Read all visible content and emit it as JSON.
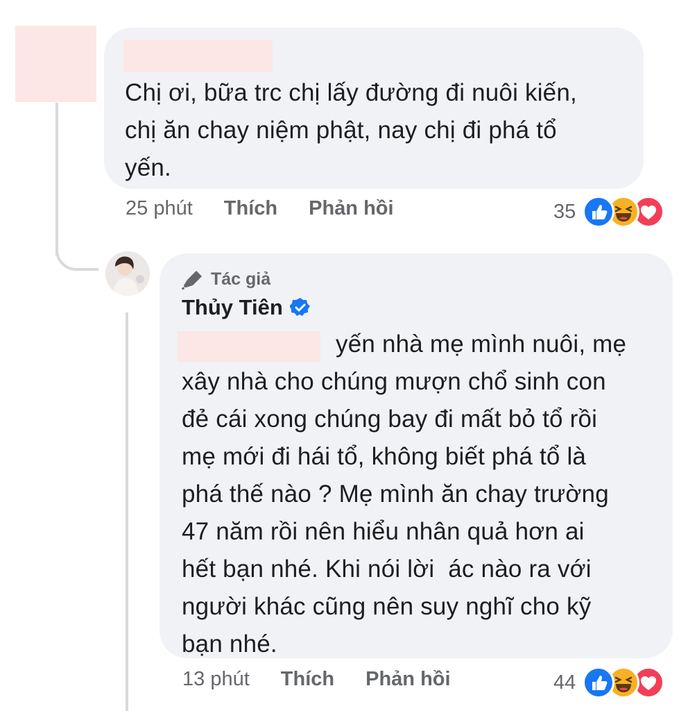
{
  "comment1": {
    "text": "Chị ơi, bữa trc chị lấy đường đi nuôi kiến,\nchị ăn chay niệm phật, nay chị đi phá tổ\nyến.",
    "time": "25 phút",
    "like_label": "Thích",
    "reply_label": "Phản hồi",
    "reaction_count": "35",
    "reactions": [
      "like-icon",
      "haha-icon",
      "love-icon"
    ]
  },
  "reply": {
    "author_tag": "Tác giả",
    "author_name": "Thủy Tiên",
    "text": "yến nhà mẹ mình nuôi, mẹ\nxây nhà cho chúng mượn chổ sinh con\nđẻ cái xong chúng bay đi mất bỏ tổ rồi\nmẹ mới đi hái tổ, không biết phá tổ là\nphá thế nào ? Mẹ mình ăn chay trường\n47 năm rồi nên hiểu nhân quả hơn ai\nhết bạn nhé. Khi nói lời  ác nào ra với\nngười khác cũng nên suy nghĩ cho kỹ\nbạn nhé.",
    "time": "13 phút",
    "like_label": "Thích",
    "reply_label": "Phản hồi",
    "reaction_count": "44",
    "reactions": [
      "like-icon",
      "haha-icon",
      "love-icon"
    ]
  },
  "colors": {
    "bubble": "#f0f2f5",
    "meta_text": "#65676b",
    "like_blue": "#1877f2",
    "haha_yellow": "#f7b125",
    "love_red": "#f33e58",
    "verified_blue": "#1877f2",
    "redaction_pink": "#fde6e6"
  }
}
